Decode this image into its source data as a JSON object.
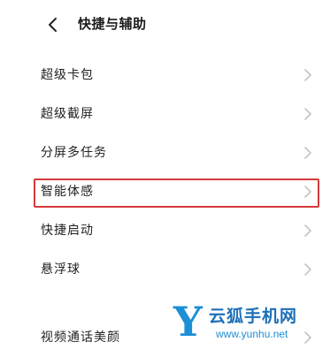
{
  "header": {
    "title": "快捷与辅助",
    "back_icon": "chevron-left-icon"
  },
  "items": [
    {
      "label": "超级卡包"
    },
    {
      "label": "超级截屏"
    },
    {
      "label": "分屏多任务"
    },
    {
      "label": "智能体感",
      "highlighted": true
    },
    {
      "label": "快捷启动"
    },
    {
      "label": "悬浮球"
    },
    {
      "label": "视频通话美颜"
    }
  ],
  "watermark": {
    "letter": "Y",
    "name": "云狐手机网",
    "url": "www.yunhu.net"
  },
  "colors": {
    "highlight": "#d63a3a",
    "watermark": "#1d8fd6",
    "chevron": "#c4c4c4"
  }
}
